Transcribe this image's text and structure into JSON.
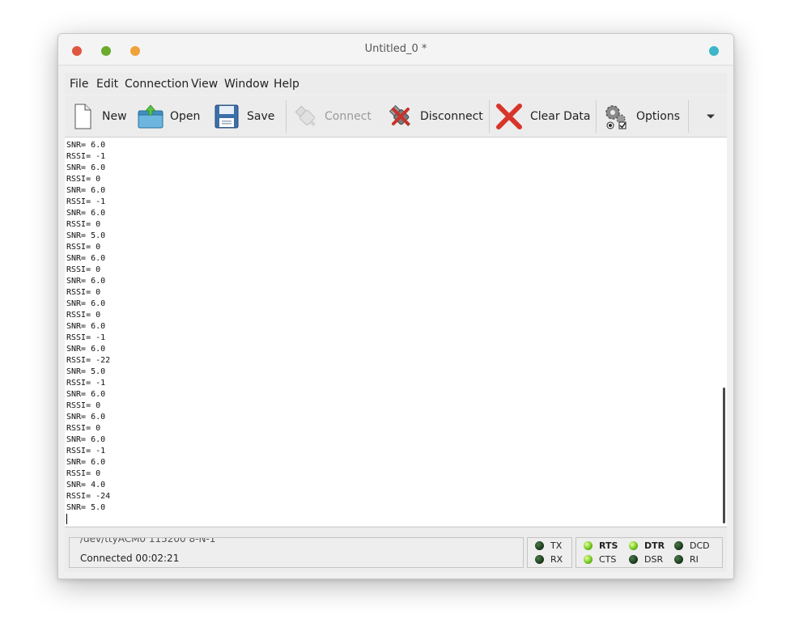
{
  "window": {
    "title": "Untitled_0 *",
    "buttons": {
      "close_color": "#e0573f",
      "minimize_color": "#6aab2b",
      "maximize_color": "#f0a13a",
      "extra_color": "#3cb6c9"
    }
  },
  "menu": [
    "File",
    "Edit",
    "Connection",
    "View",
    "Window",
    "Help"
  ],
  "toolbar": {
    "new": {
      "label": "New",
      "icon": "new-document-icon"
    },
    "open": {
      "label": "Open",
      "icon": "open-folder-icon"
    },
    "save": {
      "label": "Save",
      "icon": "save-floppy-icon"
    },
    "connect": {
      "label": "Connect",
      "icon": "usb-plug-icon",
      "enabled": false
    },
    "disconnect": {
      "label": "Disconnect",
      "icon": "disconnect-plug-icon"
    },
    "clear": {
      "label": "Clear Data",
      "icon": "red-x-icon"
    },
    "options": {
      "label": "Options",
      "icon": "gears-options-icon"
    },
    "overflow": {
      "icon": "dropdown-arrow-icon"
    }
  },
  "terminal": {
    "lines": [
      "SNR= 6.0",
      "RSSI= -1",
      "SNR= 6.0",
      "RSSI= 0",
      "SNR= 6.0",
      "RSSI= -1",
      "SNR= 6.0",
      "RSSI= 0",
      "SNR= 5.0",
      "RSSI= 0",
      "SNR= 6.0",
      "RSSI= 0",
      "SNR= 6.0",
      "RSSI= 0",
      "SNR= 6.0",
      "RSSI= 0",
      "SNR= 6.0",
      "RSSI= -1",
      "SNR= 6.0",
      "RSSI= -22",
      "SNR= 5.0",
      "RSSI= -1",
      "SNR= 6.0",
      "RSSI= 0",
      "SNR= 6.0",
      "RSSI= 0",
      "SNR= 6.0",
      "RSSI= -1",
      "SNR= 6.0",
      "RSSI= 0",
      "SNR= 4.0",
      "RSSI= -24",
      "SNR= 5.0"
    ]
  },
  "status": {
    "port_text": "/dev/ttyACM0 115200 8-N-1",
    "connection_text": "Connected 00:02:21",
    "signals": {
      "tx": {
        "label": "TX",
        "on": false
      },
      "rx": {
        "label": "RX",
        "on": false
      },
      "rts": {
        "label": "RTS",
        "on": true
      },
      "cts": {
        "label": "CTS",
        "on": true
      },
      "dtr": {
        "label": "DTR",
        "on": true
      },
      "dsr": {
        "label": "DSR",
        "on": false
      },
      "dcd": {
        "label": "DCD",
        "on": false
      },
      "ri": {
        "label": "RI",
        "on": false
      }
    }
  }
}
